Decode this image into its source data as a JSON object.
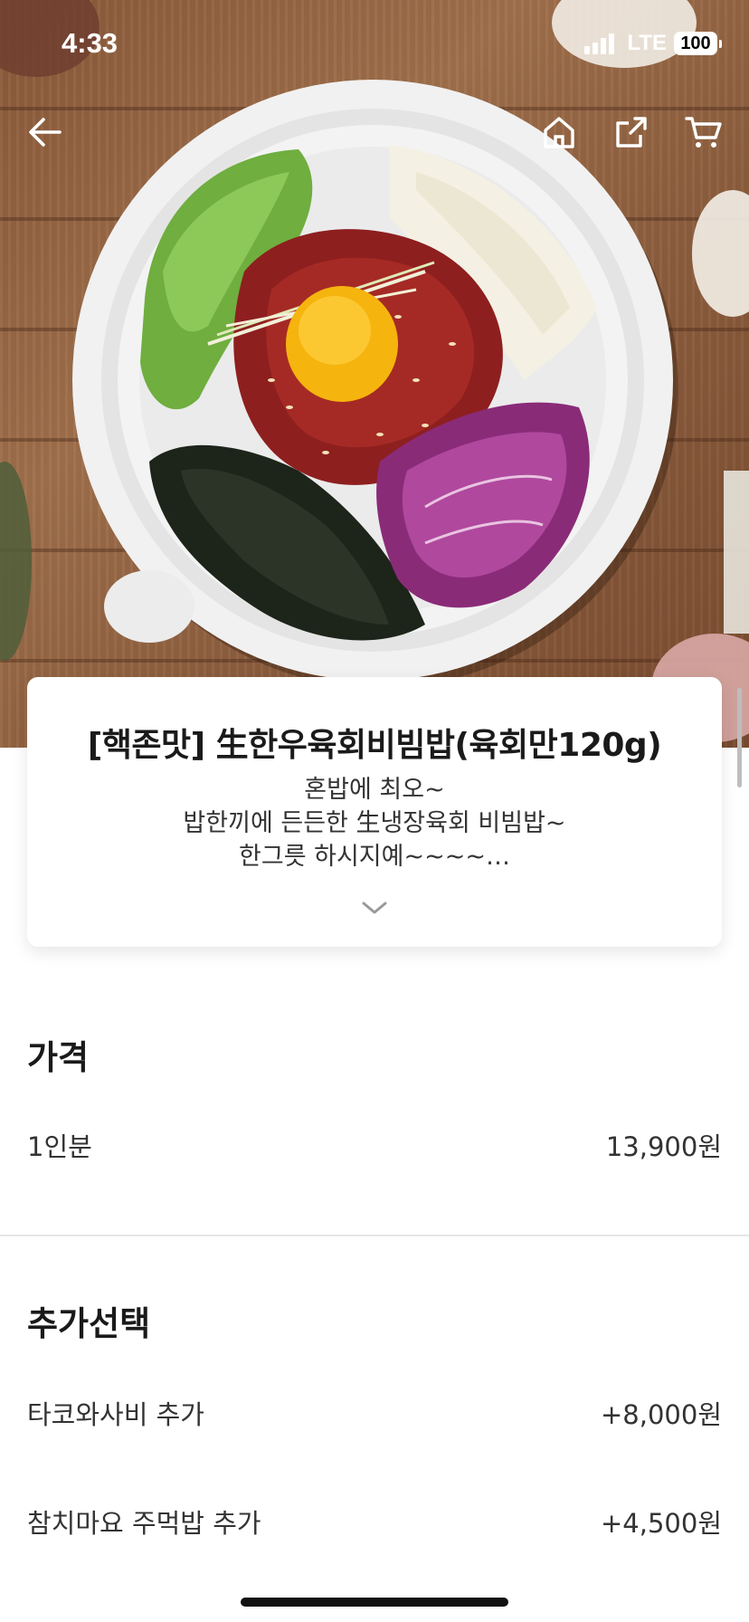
{
  "status_bar": {
    "time": "4:33",
    "network": "LTE",
    "battery": "100"
  },
  "nav": {
    "back_icon": "arrow-left-icon",
    "home_icon": "home-icon",
    "share_icon": "share-icon",
    "cart_icon": "cart-icon"
  },
  "product": {
    "title": "[핵존맛] 生한우육회비빔밥(육회만120g)",
    "description_lines": [
      "혼밥에 최오~",
      "밥한끼에 든든한 生냉장육회 비빔밥~",
      "한그릇 하시지예~~~~…"
    ],
    "expand_icon": "chevron-down-icon"
  },
  "price_section": {
    "title": "가격",
    "rows": [
      {
        "label": "1인분",
        "price": "13,900원"
      }
    ]
  },
  "options_section": {
    "title": "추가선택",
    "rows": [
      {
        "label": "타코와사비 추가",
        "price": "+8,000원"
      },
      {
        "label": "참치마요 주먹밥 추가",
        "price": "+4,500원"
      }
    ]
  },
  "colors": {
    "text_primary": "#1a1a1a",
    "text_secondary": "#333333",
    "divider": "#e6e6e6",
    "background": "#ffffff"
  }
}
